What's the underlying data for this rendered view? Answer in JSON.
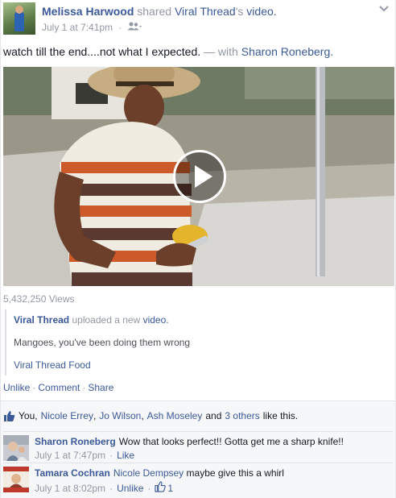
{
  "post": {
    "author": "Melissa Harwood",
    "shared_text": "shared",
    "shared_page": "Viral Thread",
    "possessive": "'s",
    "shared_object": "video.",
    "timestamp": "July 1 at 7:41pm",
    "dot": "·",
    "audience_icon": "friends-icon",
    "status_text": "watch till the end....not what I expected.",
    "with_text": "— with",
    "tagged_friend": "Sharon Roneberg."
  },
  "video": {
    "views": "5,432,250 Views",
    "play_icon": "play-icon"
  },
  "shared_attachment": {
    "source": "Viral Thread",
    "uploaded_text": "uploaded a new",
    "object_link": "video.",
    "title": "Mangoes, you've been doing them wrong",
    "footer": "Viral Thread Food"
  },
  "actions": {
    "unlike": "Unlike",
    "comment": "Comment",
    "share": "Share",
    "sep": "·"
  },
  "likes": {
    "you": "You,",
    "friend1": "Nicole Errey",
    "comma1": ",",
    "friend2": "Jo Wilson",
    "comma2": ",",
    "friend3": "Ash Moseley",
    "and_text": "and",
    "others": "3 others",
    "suffix": "like this."
  },
  "comments": [
    {
      "name": "Sharon Roneberg",
      "text": "Wow that looks perfect!! Gotta get me a sharp knife!!",
      "time": "July 1 at 7:47pm",
      "dot": "·",
      "action": "Like"
    },
    {
      "name": "Tamara Cochran",
      "mention": "Nicole Dempsey",
      "text": "maybe give this a whirl",
      "time": "July 1 at 8:02pm",
      "dot": "·",
      "action": "Unlike",
      "dot2": "·",
      "like_count": "1"
    }
  ],
  "colors": {
    "link": "#3b5998",
    "meta": "#9197a3",
    "ufi_bg": "#f6f7f9"
  }
}
